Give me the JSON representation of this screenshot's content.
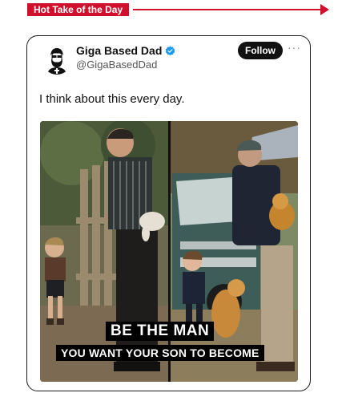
{
  "banner": {
    "label": "Hot Take of the Day"
  },
  "tweet": {
    "display_name": "Giga Based Dad",
    "handle": "@GigaBasedDad",
    "follow_label": "Follow",
    "more_label": "···",
    "text": "I think about this every day.",
    "verified": true
  },
  "image": {
    "caption_line1": "BE THE MAN",
    "caption_line2": "YOU WANT YOUR SON TO BECOME"
  },
  "colors": {
    "accent_red": "#d0102c",
    "verified_blue": "#1d9bf0"
  }
}
